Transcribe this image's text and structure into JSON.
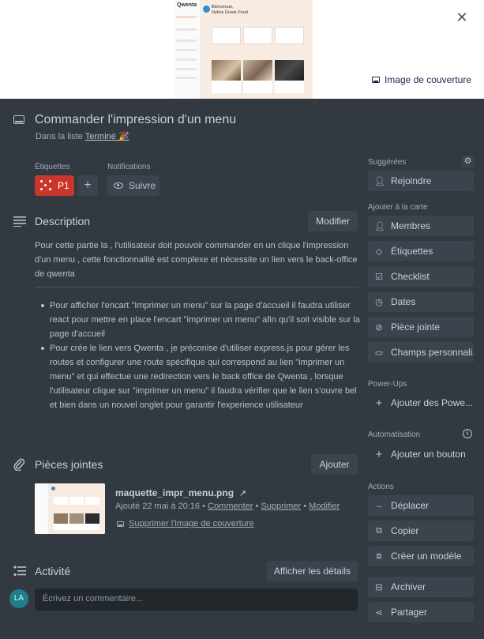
{
  "cover": {
    "thumb_logo": "Qwenta",
    "thumb_greeting_line1": "Bienvenue,",
    "thumb_greeting_line2": "Nykos Greek Food",
    "button_label": "Image de couverture",
    "close_icon": "close-icon"
  },
  "card": {
    "title": "Commander l'impression d'un menu",
    "in_list_prefix": "Dans la liste",
    "list_name": "Terminé 🎉"
  },
  "labels": {
    "heading": "Étiquettes",
    "items": [
      {
        "text": "P1",
        "color": "#c9372c"
      }
    ],
    "add_symbol": "+"
  },
  "notifications": {
    "heading": "Notifications",
    "follow_label": "Suivre"
  },
  "description": {
    "title": "Description",
    "edit_label": "Modifier",
    "paragraph": "Pour cette partie la , l'utilisateur doit pouvoir commander en un clique l'impression d'un menu , cette fonctionnalité est complexe et nécessite un lien vers le back-office de qwenta",
    "bullets": [
      "Pour afficher l'encart \"Imprimer un menu\" sur la page d'accueil il faudra utiliser react pour mettre en place l'encart \"imprimer un menu\" afin qu'il soit visible sur la page d'accueil",
      "Pour crée le lien vers Qwenta , je préconise d'utiliser express.js pour gérer les routes et configurer une route spécifique qui correspond au lien \"imprimer un menu\" et qui effectue une redirection vers le back office de Qwenta , lorsque l'utilisateur clique sur \"imprimer un menu\" il faudra vérifier que le lien s'ouvre bel et bien dans un nouvel onglet pour garantir l'experience utilisateur"
    ]
  },
  "attachments": {
    "title": "Pièces jointes",
    "add_label": "Ajouter",
    "file": {
      "name": "maquette_impr_menu.png",
      "open_symbol": "↗",
      "added": "Ajouté 22 mai à 20:16",
      "sep": " • ",
      "comment_link": "Commenter",
      "delete_link": "Supprimer",
      "edit_link": "Modifier",
      "remove_cover": "Supprimer l'image de couverture"
    }
  },
  "activity": {
    "title": "Activité",
    "details_label": "Afficher les détails",
    "avatar_initials": "LA",
    "comment_placeholder": "Écrivez un commentaire..."
  },
  "sidebar": {
    "suggested": {
      "heading": "Suggérées",
      "join": "Rejoindre"
    },
    "add_to_card": {
      "heading": "Ajouter à la carte",
      "items": [
        "Membres",
        "Étiquettes",
        "Checklist",
        "Dates",
        "Pièce jointe",
        "Champs personnali..."
      ]
    },
    "powerups": {
      "heading": "Power-Ups",
      "add": "Ajouter des Powe..."
    },
    "automation": {
      "heading": "Automatisation",
      "add": "Ajouter un bouton"
    },
    "actions": {
      "heading": "Actions",
      "items": [
        "Déplacer",
        "Copier",
        "Créer un modèle",
        "Archiver",
        "Partager"
      ]
    }
  }
}
